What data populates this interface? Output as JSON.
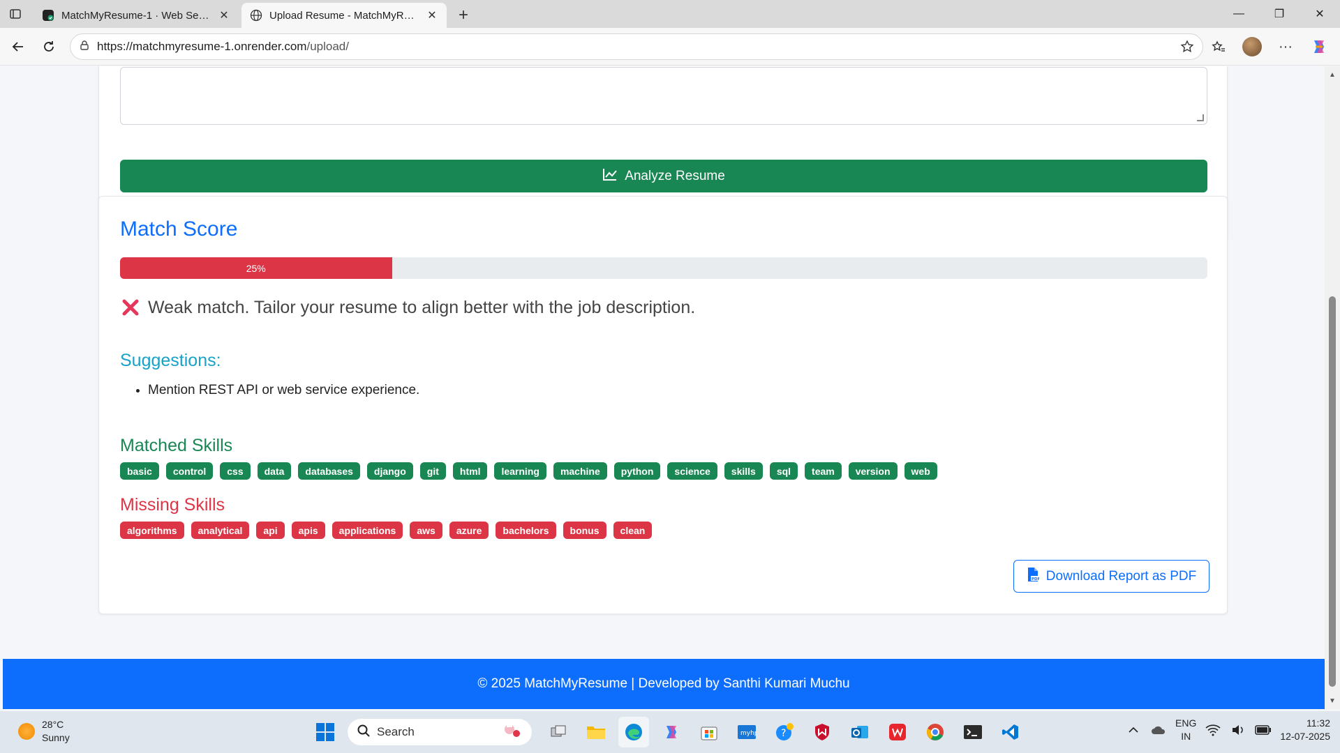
{
  "browser": {
    "tabs": [
      {
        "title": "MatchMyResume-1 · Web Service",
        "active": false
      },
      {
        "title": "Upload Resume - MatchMyResume",
        "active": true
      }
    ],
    "url_host": "https://matchmyresume-1.onrender.com",
    "url_path": "/upload/"
  },
  "form": {
    "analyze_label": "Analyze Resume"
  },
  "result": {
    "title": "Match Score",
    "score_percent": 25,
    "score_label": "25%",
    "verdict": "Weak match. Tailor your resume to align better with the job description.",
    "suggestions_title": "Suggestions:",
    "suggestions": [
      "Mention REST API or web service experience."
    ],
    "matched_title": "Matched Skills",
    "matched_skills": [
      "basic",
      "control",
      "css",
      "data",
      "databases",
      "django",
      "git",
      "html",
      "learning",
      "machine",
      "python",
      "science",
      "skills",
      "sql",
      "team",
      "version",
      "web"
    ],
    "missing_title": "Missing Skills",
    "missing_skills": [
      "algorithms",
      "analytical",
      "api",
      "apis",
      "applications",
      "aws",
      "azure",
      "bachelors",
      "bonus",
      "clean"
    ],
    "download_label": "Download Report as PDF"
  },
  "footer": {
    "text": "© 2025 MatchMyResume | Developed by Santhi Kumari Muchu"
  },
  "taskbar": {
    "temperature": "28°C",
    "condition": "Sunny",
    "search_placeholder": "Search",
    "lang_top": "ENG",
    "lang_bottom": "IN",
    "time": "11:32",
    "date": "12-07-2025"
  },
  "colors": {
    "primary": "#0d6efd",
    "success": "#198754",
    "danger": "#dc3545",
    "info": "#17a2c8"
  }
}
